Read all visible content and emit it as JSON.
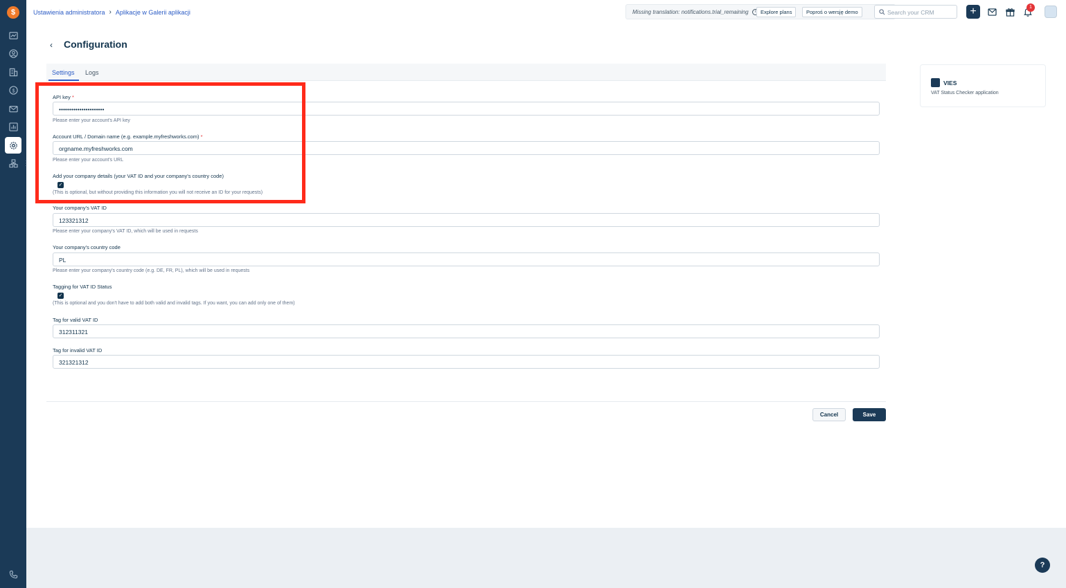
{
  "sidebar": {
    "logo_icon": "freshworks-logo-icon",
    "items": [
      {
        "icon": "dashboard-icon"
      },
      {
        "icon": "contacts-icon"
      },
      {
        "icon": "accounts-icon"
      },
      {
        "icon": "deals-icon"
      },
      {
        "icon": "mail-icon"
      },
      {
        "icon": "reports-icon"
      },
      {
        "icon": "settings-icon",
        "active": true
      },
      {
        "icon": "apps-icon"
      }
    ],
    "phone_icon": "phone-icon"
  },
  "topbar": {
    "breadcrumb": [
      "Ustawienia administratora",
      "Aplikacje w Galerii aplikacji"
    ],
    "trial_text": "Missing translation: notifications.trial_remaining",
    "explore_plans": "Explore plans",
    "request_demo": "Poproś o wersję demo",
    "search_placeholder": "Search your CRM",
    "notification_count": "1"
  },
  "page": {
    "title": "Configuration",
    "tabs": [
      "Settings",
      "Logs"
    ],
    "active_tab": "Settings"
  },
  "form": {
    "api_key": {
      "label": "API key",
      "required": "*",
      "value": "••••••••••••••••••••••",
      "hint": "Please enter your account's API key"
    },
    "account_url": {
      "label": "Account URL / Domain name (e.g. example.myfreshworks.com)",
      "required": "*",
      "value": "orgname.myfreshworks.com",
      "hint": "Please enter your account's URL"
    },
    "company_details": {
      "label": "Add your company details (your VAT ID and your company's country code)",
      "checked": true,
      "hint": "(This is optional, but without providing this information you will not receive an ID for your requests)"
    },
    "vat_id": {
      "label": "Your company's VAT ID",
      "value": "123321312",
      "hint": "Please enter your company's VAT ID, which will be used in requests"
    },
    "country_code": {
      "label": "Your company's country code",
      "value": "PL",
      "hint": "Please enter your company's country code (e.g. DE, FR, PL), which will be used in requests"
    },
    "tagging": {
      "label": "Tagging for VAT ID Status",
      "checked": true,
      "hint": "(This is optional and you don't have to add both valid and invalid tags. If you want, you can add only one of them)"
    },
    "valid_tag": {
      "label": "Tag for valid VAT ID",
      "value": "312311321"
    },
    "invalid_tag": {
      "label": "Tag for invalid VAT ID",
      "value": "321321312"
    }
  },
  "actions": {
    "cancel": "Cancel",
    "save": "Save"
  },
  "app_card": {
    "name": "VIES",
    "description": "VAT Status Checker application"
  },
  "help_label": "?",
  "colors": {
    "sidebar": "#1b3a57",
    "link": "#2c5cc5",
    "highlight": "#ff2a1a"
  }
}
